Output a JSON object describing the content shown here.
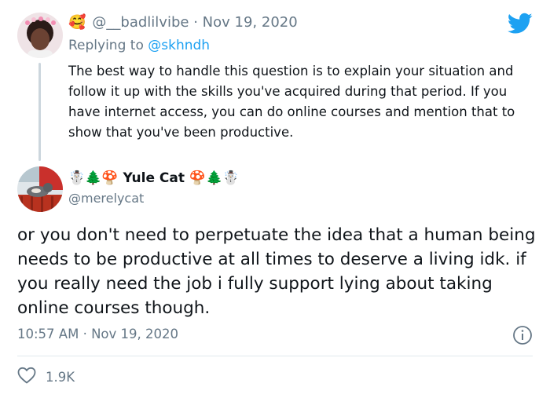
{
  "parent_tweet": {
    "author_emoji": "🥰",
    "handle": "@__badlilvibe",
    "separator": "·",
    "date": "Nov 19, 2020",
    "replying_prefix": "Replying to",
    "replying_to": "@skhndh",
    "text": "The best way to handle this question is to explain your situation and follow it up with the skills you've acquired during that period. If you have internet access, you can do online courses and mention that to show that you've been productive."
  },
  "main_tweet": {
    "name": "Yule Cat",
    "name_prefix_emoji": "☃️🌲🍄",
    "name_suffix_emoji": "🍄🌲☃️",
    "handle": "@merelycat",
    "text": "or you don't need to perpetuate the idea that a human being needs to be productive at all times to deserve a living idk. if you really need the job i fully support lying about taking online courses though.",
    "time": "10:57 AM",
    "separator": "·",
    "date": "Nov 19, 2020",
    "likes": "1.9K"
  },
  "colors": {
    "accent": "#1da1f2",
    "muted": "#657786",
    "text": "#0f1419"
  },
  "icons": {
    "brand": "twitter-bird-icon",
    "like": "heart-icon",
    "info": "info-icon"
  }
}
